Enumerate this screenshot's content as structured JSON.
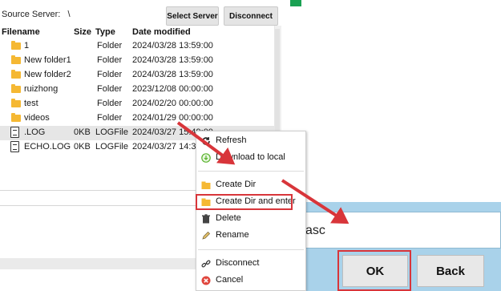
{
  "header": {
    "source_label": "Source Server:",
    "source_value": "\\",
    "select_server": "Select Server",
    "disconnect": "Disconnect"
  },
  "columns": [
    "Filename",
    "Size",
    "Type",
    "Date modified"
  ],
  "rows": [
    {
      "icon": "folder-icon",
      "name": "1",
      "size": "",
      "type": "Folder",
      "date": "2024/03/28 13:59:00"
    },
    {
      "icon": "folder-icon",
      "name": "New folder1",
      "size": "",
      "type": "Folder",
      "date": "2024/03/28 13:59:00"
    },
    {
      "icon": "folder-icon",
      "name": "New folder2",
      "size": "",
      "type": "Folder",
      "date": "2024/03/28 13:59:00"
    },
    {
      "icon": "folder-icon",
      "name": "ruizhong",
      "size": "",
      "type": "Folder",
      "date": "2023/12/08 00:00:00"
    },
    {
      "icon": "folder-icon",
      "name": "test",
      "size": "",
      "type": "Folder",
      "date": "2024/02/20 00:00:00"
    },
    {
      "icon": "folder-icon",
      "name": "videos",
      "size": "",
      "type": "Folder",
      "date": "2024/01/29 00:00:00"
    },
    {
      "icon": "file-icon",
      "name": ".LOG",
      "size": "0KB",
      "type": "LOGFile",
      "date": "2024/03/27 15:49:00"
    },
    {
      "icon": "file-icon",
      "name": "ECHO.LOG",
      "size": "0KB",
      "type": "LOGFile",
      "date": "2024/03/27 14:35"
    }
  ],
  "context_menu": {
    "refresh": "Refresh",
    "download": "Download to local",
    "create_dir": "Create Dir",
    "create_dir_enter": "Create Dir and enter",
    "delete": "Delete",
    "rename": "Rename",
    "disconnect": "Disconnect",
    "cancel": "Cancel"
  },
  "dialog": {
    "input_value": "asc",
    "ok": "OK",
    "back": "Back"
  },
  "colors": {
    "highlight_red": "#d8353a",
    "dialog_bg": "#a9d2ea",
    "folder": "#f5b833",
    "accent_green": "#1aa153"
  }
}
